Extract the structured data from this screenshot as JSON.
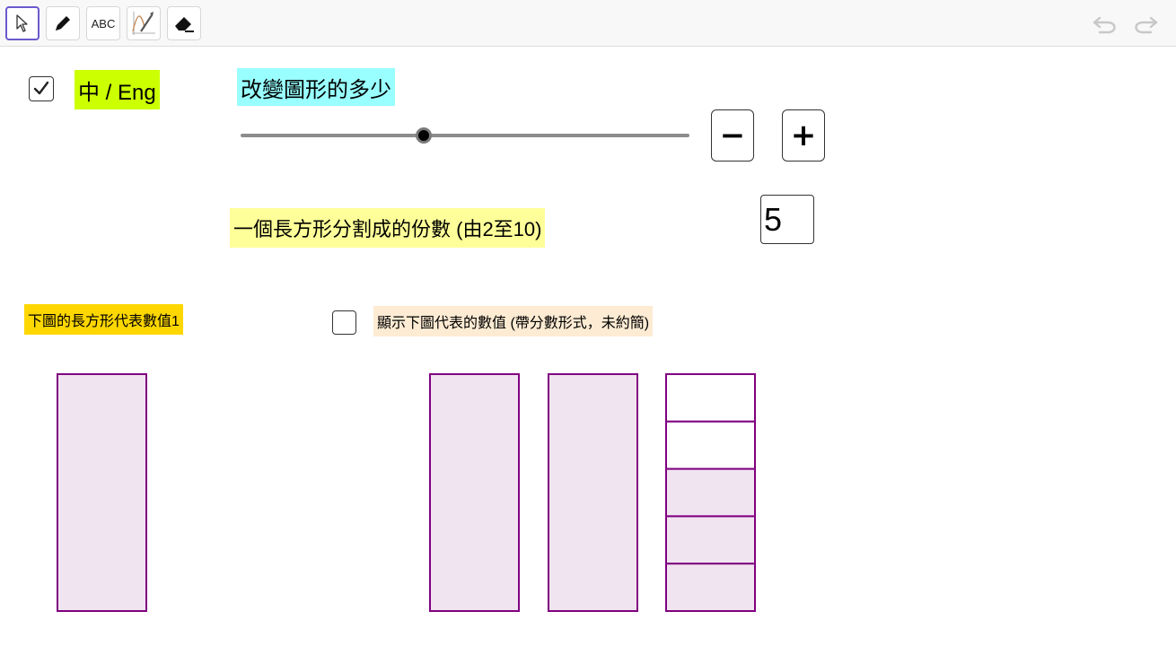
{
  "toolbar": {
    "tools": [
      {
        "name": "move",
        "icon": "arrow-pointer-icon"
      },
      {
        "name": "pen",
        "icon": "pen-icon"
      },
      {
        "name": "text",
        "label": "ABC",
        "icon": "text-icon"
      },
      {
        "name": "function",
        "icon": "function-inspector-icon"
      },
      {
        "name": "eraser",
        "icon": "eraser-icon"
      }
    ],
    "undo_icon": "undo-icon",
    "redo_icon": "redo-icon"
  },
  "language_toggle": {
    "checked": true,
    "label": "中 / Eng"
  },
  "slider_title": "改變圖形的多少",
  "slider": {
    "value_fraction": 0.414
  },
  "minus_label": "−",
  "plus_label": "+",
  "parts_label": "一個長方形分割成的份數 (由2至10)",
  "parts_value": "5",
  "unit_label": "下圖的長方形代表數值1",
  "show_value": {
    "checked": false,
    "label": "顯示下圖代表的數值 (帶分數形式，未約簡)"
  },
  "figure": {
    "parts": 5,
    "shaded_parts": 3,
    "whole_count": 2,
    "fill_color": "#f1e4f1",
    "stroke_color": "#800080"
  },
  "colors": {
    "lang_bg": "#ccff00",
    "slider_title_bg": "#99ffff",
    "parts_label_bg": "#ffff99",
    "unit_label_bg": "#ffd700",
    "show_value_bg": "#fdebd3",
    "tool_active": "#6a5acd"
  }
}
